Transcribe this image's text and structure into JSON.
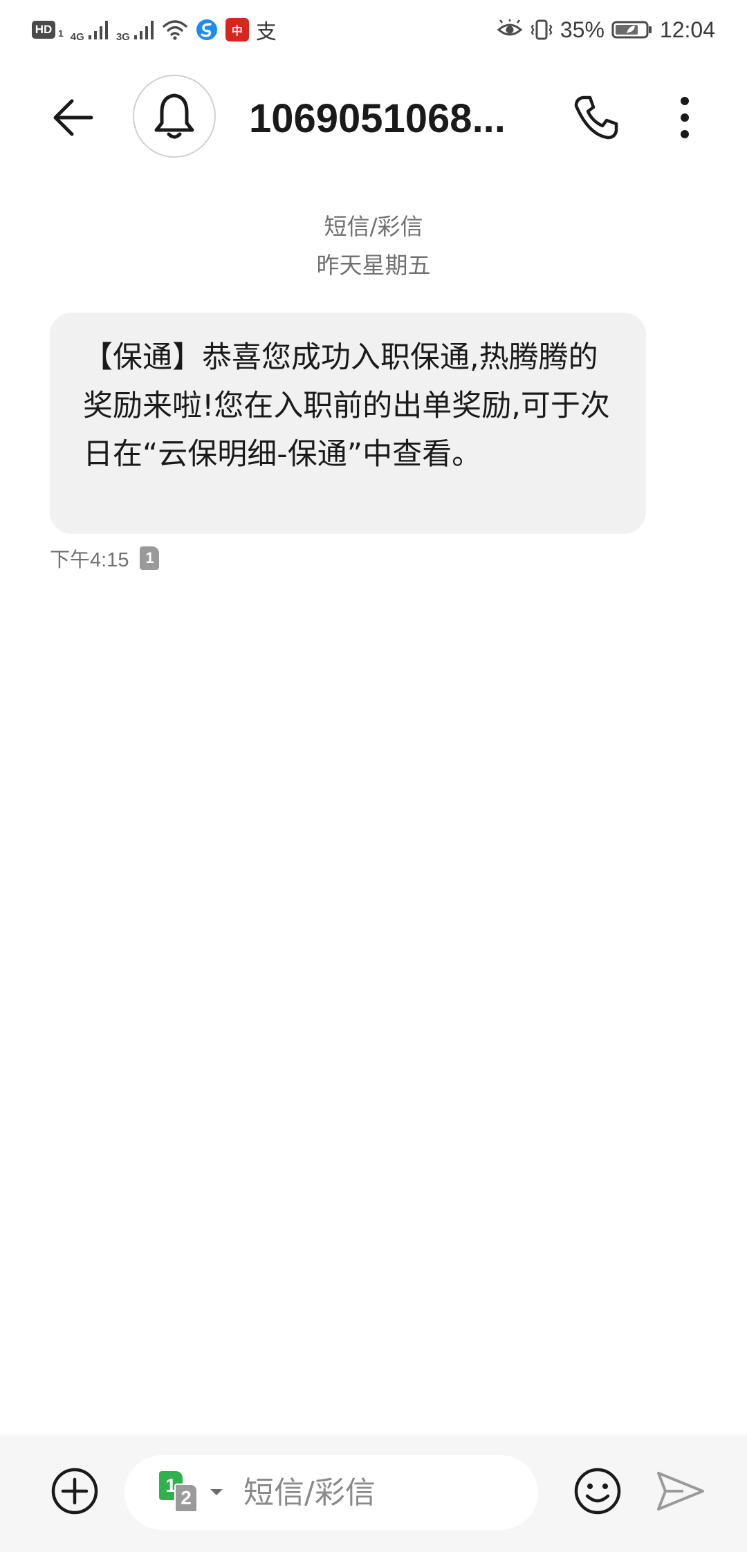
{
  "status_bar": {
    "hd_label": "HD",
    "sim_index": "1",
    "network_1": "4G",
    "network_2": "3G",
    "app_red_label": "中",
    "app_zhi_label": "支",
    "battery_percent": "35%",
    "battery_level": 0.35,
    "time": "12:04"
  },
  "header": {
    "contact_name": "1069051068..."
  },
  "conversation": {
    "channel_label": "短信/彩信",
    "day_label": "昨天星期五",
    "messages": [
      {
        "text": "【保通】恭喜您成功入职保通,热腾腾的奖励来啦!您在入职前的出单奖励,可于次日在“云保明细-保通”中查看。",
        "time": "下午4:15",
        "sim": "1"
      }
    ]
  },
  "composer": {
    "sim_primary": "1",
    "sim_secondary": "2",
    "placeholder": "短信/彩信",
    "value": ""
  },
  "colors": {
    "bubble_bg": "#f1f1f1",
    "composer_bg": "#f6f6f6",
    "sim_green": "#2fb24c",
    "app_red": "#d9261c"
  }
}
